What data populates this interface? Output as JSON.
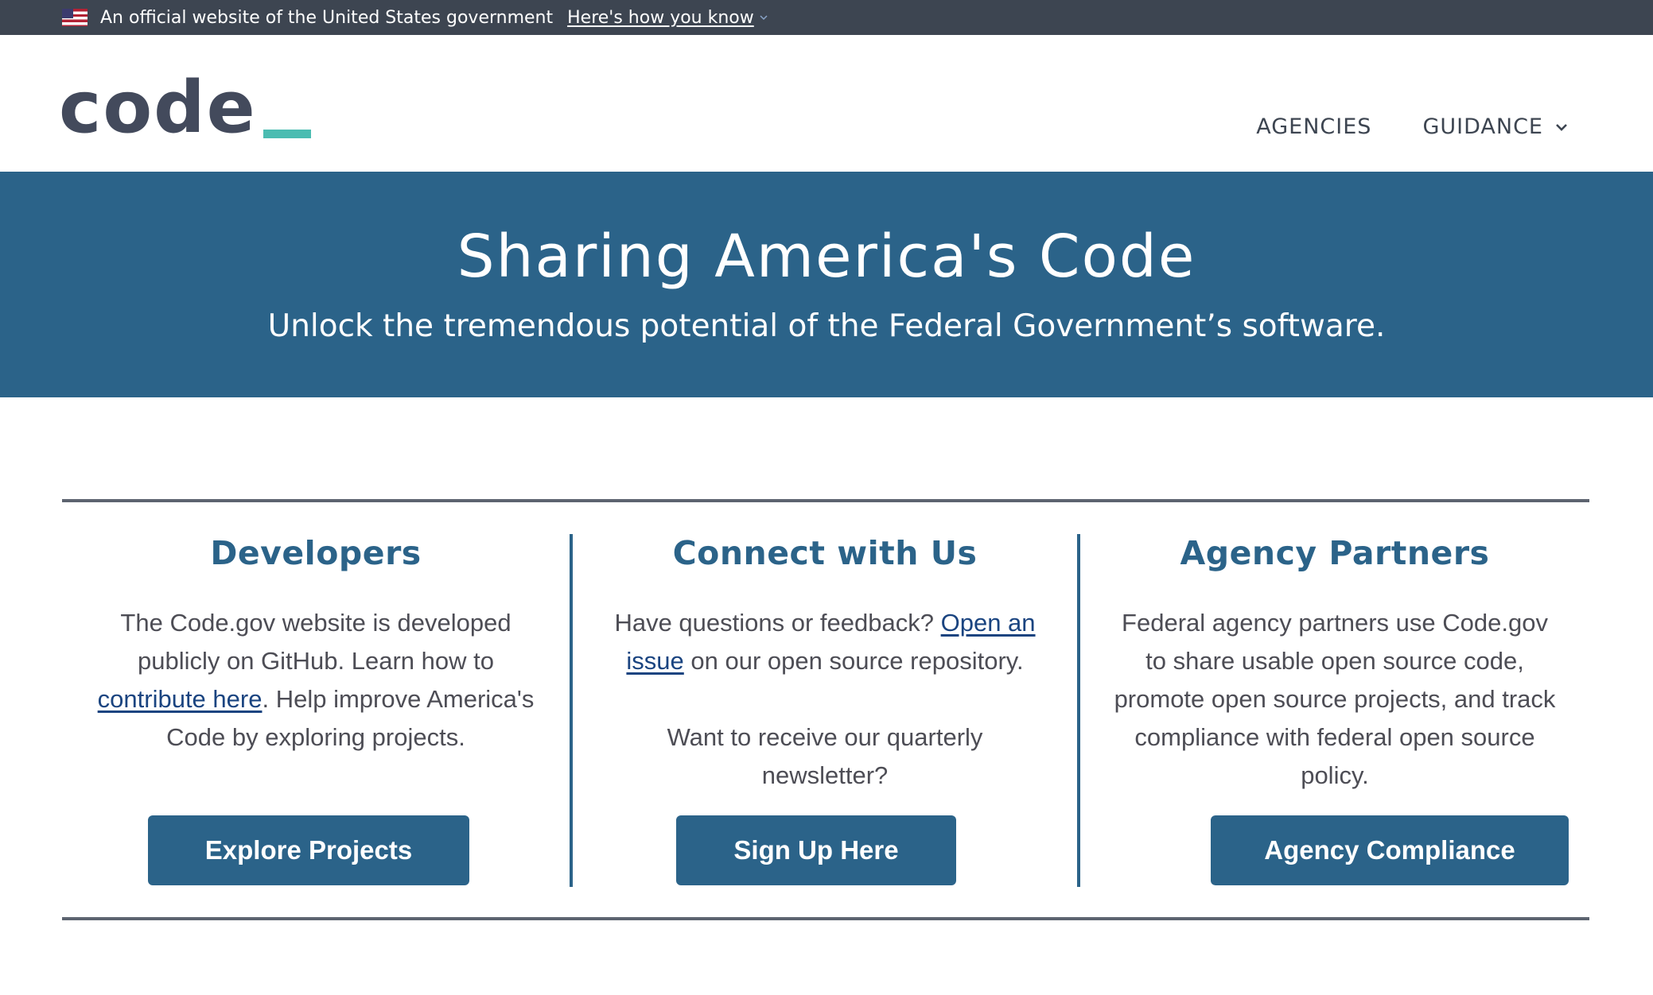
{
  "gov_banner": {
    "official_text": "An official website of the United States government",
    "how_you_know_link": "Here's how you know",
    "flag_icon": "us-flag-icon",
    "chevron_icon": "chevron-down-icon"
  },
  "header": {
    "logo_text": "code",
    "nav": [
      {
        "label": "AGENCIES",
        "has_dropdown": false
      },
      {
        "label": "GUIDANCE",
        "has_dropdown": true
      }
    ]
  },
  "hero": {
    "title": "Sharing America's Code",
    "subtitle": "Unlock the tremendous potential of the Federal Government’s software."
  },
  "features": [
    {
      "heading": "Developers",
      "text_before_link": "The Code.gov website is developed publicly on GitHub. Learn how to ",
      "link": "contribute here",
      "text_after_link": ". Help improve America's Code by exploring projects.",
      "button": "Explore Projects"
    },
    {
      "heading": "Connect with Us",
      "text_before_link": "Have questions or feedback? ",
      "link": "Open an issue",
      "text_after_link": " on our open source repository.",
      "extra_text": "Want to receive our quarterly newsletter?",
      "button": "Sign Up Here"
    },
    {
      "heading": "Agency Partners",
      "text": "Federal agency partners use Code.gov to share usable open source code, promote open source projects, and track compliance with federal open source policy.",
      "button": "Agency Compliance"
    }
  ],
  "colors": {
    "banner_bg": "#3d4551",
    "primary": "#2b6389",
    "logo_accent": "#4bbcb1",
    "logo_text": "#434a5c",
    "link": "#1a4480"
  }
}
